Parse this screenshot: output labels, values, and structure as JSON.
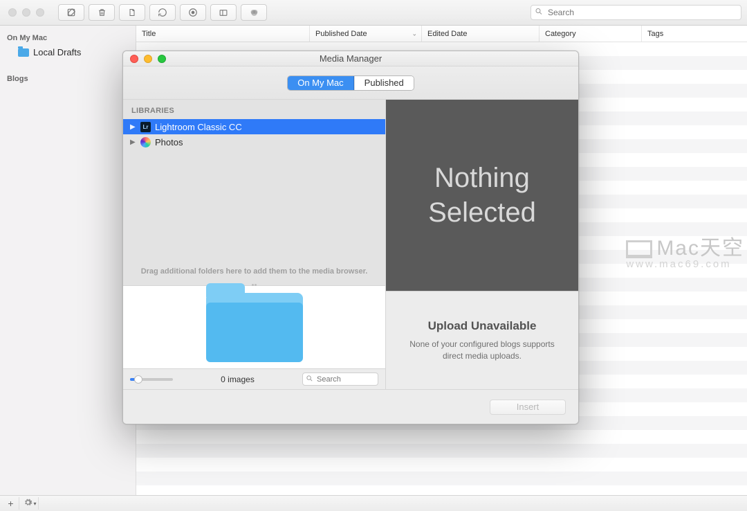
{
  "toolbar": {
    "search_placeholder": "Search"
  },
  "sidebar": {
    "section1_title": "On My Mac",
    "section1_items": [
      {
        "label": "Local Drafts"
      }
    ],
    "section2_title": "Blogs"
  },
  "columns": {
    "title": "Title",
    "published": "Published Date",
    "edited": "Edited Date",
    "category": "Category",
    "tags": "Tags"
  },
  "modal": {
    "title": "Media Manager",
    "tabs": {
      "on_my_mac": "On My Mac",
      "published": "Published"
    },
    "libraries_header": "LIBRARIES",
    "libraries": [
      {
        "label": "Lightroom Classic CC",
        "icon": "lightroom",
        "selected": true
      },
      {
        "label": "Photos",
        "icon": "photos",
        "selected": false
      }
    ],
    "drag_hint": "Drag additional folders here to add them to the media browser.",
    "image_count": "0 images",
    "lib_search_placeholder": "Search",
    "preview_line1": "Nothing",
    "preview_line2": "Selected",
    "upload_title": "Upload Unavailable",
    "upload_body": "None of your configured blogs supports direct media uploads.",
    "insert_label": "Insert"
  },
  "watermark": {
    "line1": "Mac天空",
    "line2": "www.mac69.com"
  }
}
